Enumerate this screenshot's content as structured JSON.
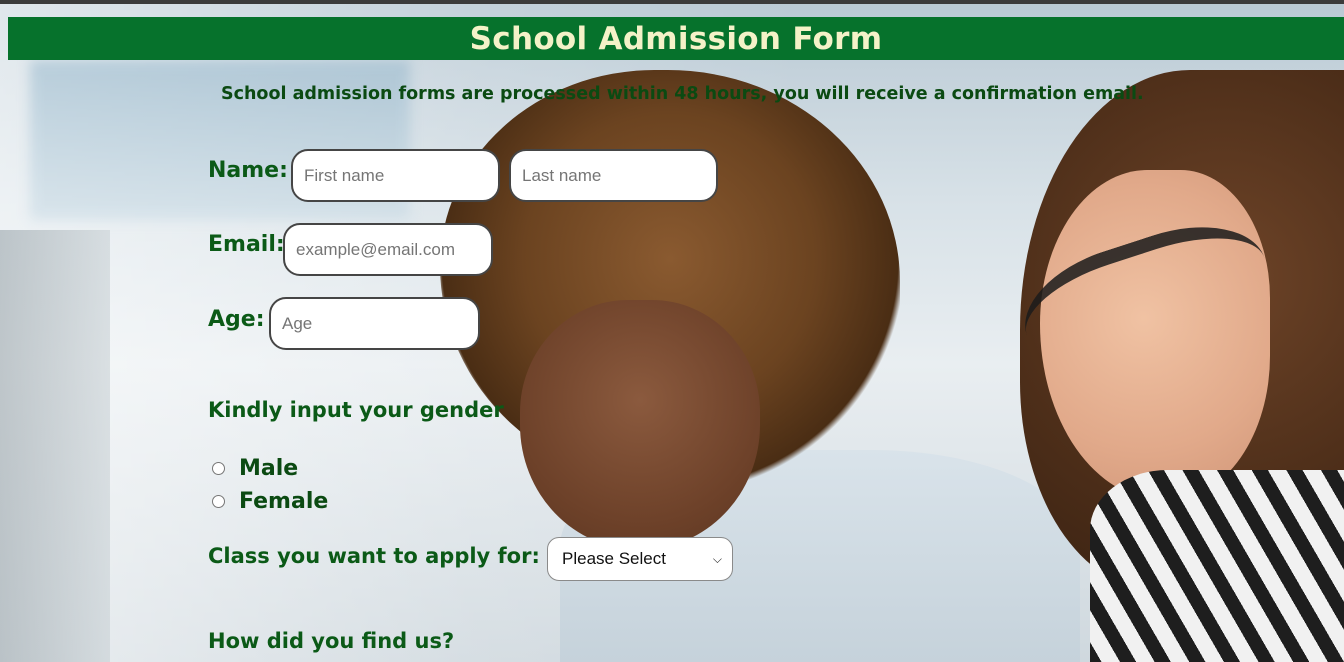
{
  "header": {
    "title": "School Admission Form"
  },
  "notice": "School admission forms are processed within 48 hours, you will receive a confirmation email.",
  "form": {
    "name_label": "Name:",
    "first_name_placeholder": "First name",
    "last_name_placeholder": "Last name",
    "email_label": "Email:",
    "email_placeholder": "example@email.com",
    "age_label": "Age:",
    "age_placeholder": "Age",
    "gender_prompt": "Kindly input your gender",
    "gender_options": [
      "Male",
      "Female"
    ],
    "class_label": "Class you want to apply for:",
    "class_select_value": "Please Select",
    "find_us_label": "How did you find us?"
  },
  "colors": {
    "header_bg": "#06722c",
    "header_text": "#f4f2c8",
    "label_text": "#0b5a17"
  },
  "icons": {
    "select_chevron": "chevron-down-icon"
  }
}
